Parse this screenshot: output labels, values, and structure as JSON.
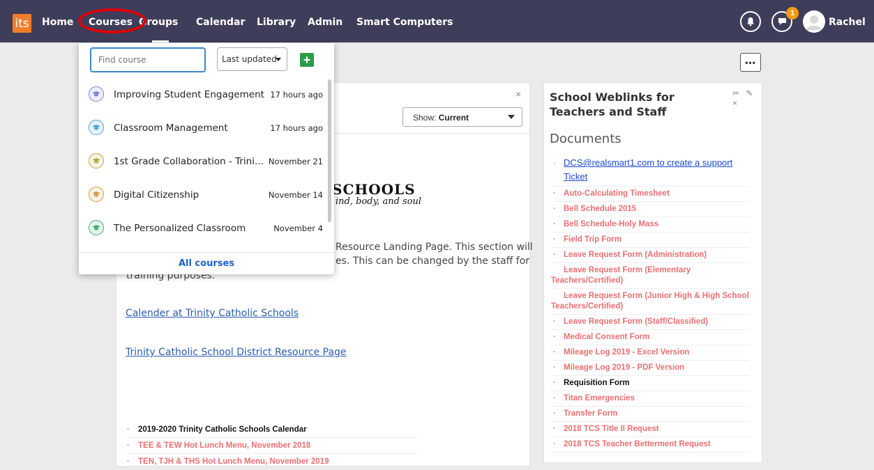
{
  "nav": {
    "logo": "its",
    "items": [
      "Home",
      "Courses",
      "Groups",
      "Calendar",
      "Library",
      "Admin",
      "Smart Computers"
    ],
    "notification_count": "1",
    "username": "Rachel"
  },
  "toolbar": {
    "more_label": "•••"
  },
  "center": {
    "close": "×",
    "show_label": "Show:",
    "show_value": "Current",
    "school_title": "SCHOOLS",
    "school_motto": "ind, body, and soul",
    "body_line1": "Resource Landing Page.  This section will",
    "body_line2": "es.  This can be changed by the staff for",
    "body_line3": "training purposes.",
    "link1": "Calender at Trinity Catholic Schools",
    "link2": "Trinity Catholic School District Resource Page",
    "calendar_items": [
      "2019-2020 Trinity Catholic Schools Calendar",
      "TEE & TEW Hot Lunch Menu, November 2018",
      "TEN, TJH & THS Hot Lunch Menu, November 2019"
    ]
  },
  "weblinks": {
    "title": "School Weblinks for Teachers and Staff",
    "tools": "✂ ✎ ×",
    "heading": "Documents",
    "support": "DCS@realsmart1.com  to create a support Ticket",
    "documents": [
      "Auto-Calculating Timesheet",
      "Bell Schedule 2015",
      "Bell Schedule-Holy Mass",
      "Field Trip Form",
      "Leave Request Form (Administration)",
      "Leave Request Form (Elementary Teachers/Certified)",
      "Leave Request Form (Junior High & High School Teachers/Certified)",
      "Leave Request Form (Staff/Classified)",
      "Medical Consent Form",
      "Mileage Log 2019 - Excel Version",
      "Mileage Log 2019 - PDF Version",
      "Requisition Form",
      "Titan Emergencies",
      "Transfer Form",
      "2018 TCS Title II Request",
      "2018 TCS Teacher Betterment Request"
    ]
  },
  "courses_dropdown": {
    "search_placeholder": "Find course",
    "sort_label": "Last updated",
    "add_label": "+",
    "items": [
      {
        "name": "Improving Student Engagement",
        "time": "17 hours ago",
        "color": "#7b7fd6"
      },
      {
        "name": "Classroom Management",
        "time": "17 hours ago",
        "color": "#4aa3d4"
      },
      {
        "name": "1st Grade Collaboration - Trini...",
        "time": "November 21",
        "color": "#b5a73a"
      },
      {
        "name": "Digital Citizenship",
        "time": "November 14",
        "color": "#d59a3c"
      },
      {
        "name": "The Personalized Classroom",
        "time": "November 4",
        "color": "#3fae6a"
      }
    ],
    "all_courses": "All courses"
  }
}
